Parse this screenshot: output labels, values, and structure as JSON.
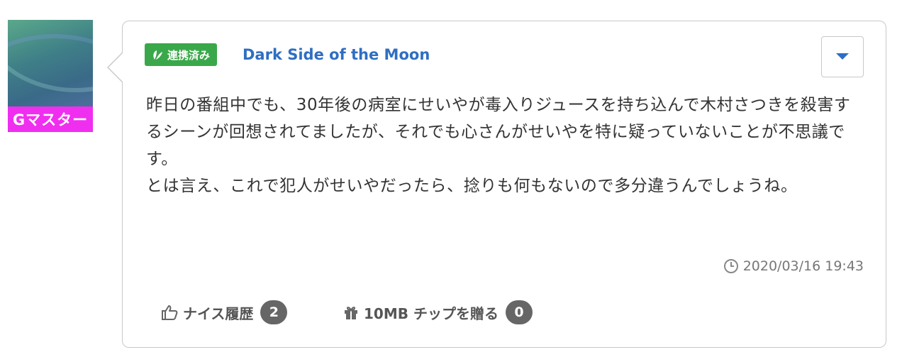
{
  "user": {
    "rank_badge": "Gマスター",
    "linked_badge": "連携済み",
    "username": "Dark Side of the Moon"
  },
  "post": {
    "paragraphs": [
      "昨日の番組中でも、30年後の病室にせいやが毒入りジュースを持ち込んで木村さつきを殺害するシーンが回想されてましたが、それでも心さんがせいやを特に疑っていないことが不思議です。",
      "とは言え、これで犯人がせいやだったら、捻りも何もないので多分違うんでしょうね。"
    ],
    "timestamp": "2020/03/16 19:43"
  },
  "actions": {
    "nice_label": "ナイス履歴",
    "nice_count": "2",
    "tip_label": "10MB チップを贈る",
    "tip_count": "0"
  },
  "colors": {
    "rank_badge": "#f02ef0",
    "linked_badge": "#3aa84a",
    "username": "#2f6ec2",
    "menu_caret": "#2f6ec2"
  },
  "icons": [
    "avatar-image",
    "leaf-icon",
    "caret-down-icon",
    "clock-icon",
    "thumbs-up-icon",
    "gift-icon"
  ]
}
